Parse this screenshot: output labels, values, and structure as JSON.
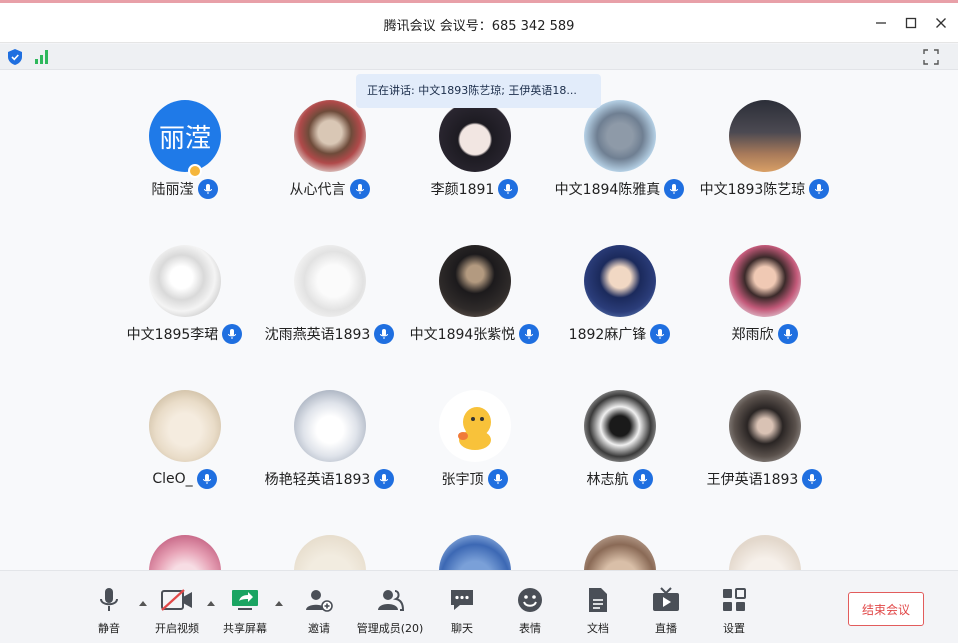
{
  "window": {
    "title": "腾讯会议 会议号：685 342 589"
  },
  "banner": {
    "speaking_text": "正在讲话: 中文1893陈艺琼; 王伊英语18..."
  },
  "participants": [
    {
      "name": "陆丽滢",
      "avatar_text": "丽滢",
      "host": true
    },
    {
      "name": "从心代言"
    },
    {
      "name": "李颜1891"
    },
    {
      "name": "中文1894陈雅真"
    },
    {
      "name": "中文1893陈艺琼"
    },
    {
      "name": "中文1895李珺"
    },
    {
      "name": "沈雨燕英语1893"
    },
    {
      "name": "中文1894张紫悦"
    },
    {
      "name": "1892麻广锋"
    },
    {
      "name": "郑雨欣"
    },
    {
      "name": "CleO_"
    },
    {
      "name": "杨艳轻英语1893"
    },
    {
      "name": "张宇顶"
    },
    {
      "name": "林志航"
    },
    {
      "name": "王伊英语1893"
    }
  ],
  "toolbar": {
    "mute": "静音",
    "video": "开启视频",
    "share": "共享屏幕",
    "invite": "邀请",
    "members": "管理成员(20)",
    "chat": "聊天",
    "emoji": "表情",
    "docs": "文档",
    "live": "直播",
    "settings": "设置",
    "end": "结束会议"
  },
  "colors": {
    "accent": "#1f6fe0",
    "end_red": "#e14848",
    "speaking_bg": "#e2ecfa"
  }
}
